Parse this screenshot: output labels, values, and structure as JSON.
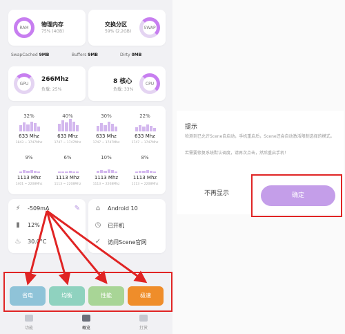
{
  "memory": {
    "ram": {
      "ring_label": "RAM",
      "title": "物理内存",
      "detail": "75% (4GB)",
      "level": 0.75
    },
    "swap": {
      "ring_label": "SWAP",
      "title": "交换分区",
      "detail": "59% (2.2GB)",
      "level": 0.59
    }
  },
  "stats": [
    {
      "label": "SwapCached",
      "value": "9MB"
    },
    {
      "label": "Buffers",
      "value": "9MB"
    },
    {
      "label": "Dirty",
      "value": "0MB"
    }
  ],
  "gpu": {
    "ring_label": "GPU",
    "freq": "266Mhz",
    "load": "负载: 25%"
  },
  "cpu": {
    "ring_label": "CPU",
    "cores": "8 核心",
    "load": "负载: 33%"
  },
  "cores": [
    {
      "pct": "32%",
      "freq": "633 Mhz",
      "range": "1843 ~ 1747Mhz",
      "level": 0.32
    },
    {
      "pct": "40%",
      "freq": "633 Mhz",
      "range": "1747 ~ 1747Mhz",
      "level": 0.4
    },
    {
      "pct": "30%",
      "freq": "633 Mhz",
      "range": "1747 ~ 1747Mhz",
      "level": 0.3
    },
    {
      "pct": "22%",
      "freq": "633 Mhz",
      "range": "1747 ~ 1747Mhz",
      "level": 0.22
    },
    {
      "pct": "9%",
      "freq": "1113 Mhz",
      "range": "1401 ~ 2208Mhz",
      "level": 0.09
    },
    {
      "pct": "6%",
      "freq": "1113 Mhz",
      "range": "1113 ~ 2208Mhz",
      "level": 0.06
    },
    {
      "pct": "10%",
      "freq": "1113 Mhz",
      "range": "1113 ~ 2208Mhz",
      "level": 0.1
    },
    {
      "pct": "8%",
      "freq": "1113 Mhz",
      "range": "1113 ~ 2208Mhz",
      "level": 0.08
    }
  ],
  "info_left": [
    {
      "icon": "plug-icon",
      "text": "-509mA"
    },
    {
      "icon": "battery-icon",
      "text": "12%"
    },
    {
      "icon": "temperature-icon",
      "text": "30.0°C"
    }
  ],
  "info_right": [
    {
      "icon": "android-icon",
      "text": "Android 10"
    },
    {
      "icon": "clock-icon",
      "text": "已开机"
    },
    {
      "icon": "scene-icon",
      "text": "访问Scene官网"
    }
  ],
  "modes": [
    {
      "label": "省电",
      "color": "#8fc3d8"
    },
    {
      "label": "均衡",
      "color": "#8fd2bf"
    },
    {
      "label": "性能",
      "color": "#a8d596"
    },
    {
      "label": "极速",
      "color": "#ef8d2a"
    }
  ],
  "bottom_nav": [
    {
      "label": "功能"
    },
    {
      "label": "概览"
    },
    {
      "label": "打赏"
    }
  ],
  "dialog": {
    "title": "提示",
    "line1": "检测到已允许Scene自启动，手机重启后，Scene还会自动激活限制选择的模式。",
    "line2": "若需要修复系统默认调度，请再次点击，然后重启手机！",
    "cancel": "不再显示",
    "confirm": "确定"
  },
  "colors": {
    "accent": "#c77ef0",
    "annotation": "#e02424",
    "confirm_button": "#c49ee9"
  }
}
